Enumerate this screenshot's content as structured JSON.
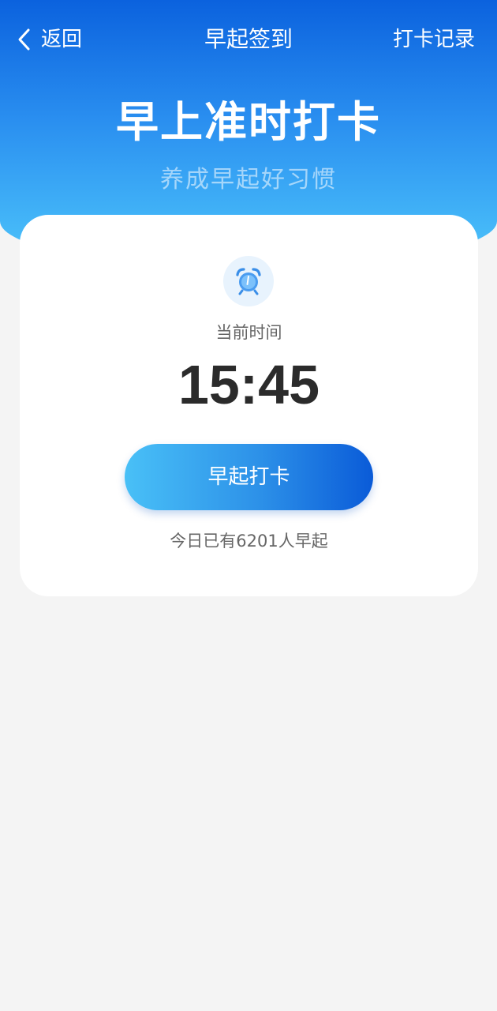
{
  "nav": {
    "back_label": "返回",
    "title": "早起签到",
    "records_label": "打卡记录"
  },
  "hero": {
    "title": "早上准时打卡",
    "subtitle": "养成早起好习惯"
  },
  "card": {
    "time_label": "当前时间",
    "time_value": "15:45",
    "button_label": "早起打卡",
    "today_count": "今日已有6201人早起"
  },
  "icons": {
    "back": "chevron-left-icon",
    "clock": "alarm-clock-icon"
  },
  "colors": {
    "brand_dark": "#0b62de",
    "brand_light": "#4ec6fb",
    "background": "#f4f4f4",
    "card": "#ffffff",
    "text_primary": "#2b2b2b",
    "text_secondary": "#666666"
  }
}
